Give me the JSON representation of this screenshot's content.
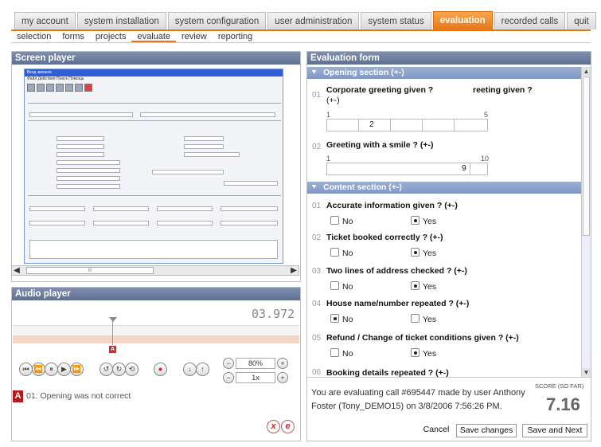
{
  "tabs": [
    "my account",
    "system installation",
    "system configuration",
    "user administration",
    "system status",
    "evaluation",
    "recorded calls",
    "quit"
  ],
  "active_tab": "evaluation",
  "subnav": [
    "selection",
    "forms",
    "projects",
    "evaluate",
    "review",
    "reporting"
  ],
  "active_sub": "evaluate",
  "screen_player": {
    "title": "Screen player",
    "scroll_label": "III"
  },
  "thumb": {
    "window_title": "Вход звонков",
    "menu": "Файл   Действия   Поиск   Помощь"
  },
  "audio_player": {
    "title": "Audio player",
    "time": "03.972",
    "marker": "A",
    "volume": "80%",
    "speed": "1x"
  },
  "comment": {
    "badge": "A",
    "text": "01: Opening was not correct"
  },
  "eval": {
    "title": "Evaluation form",
    "sections": [
      {
        "title": "Opening section (+-)"
      },
      {
        "title": "Content section (+-)"
      }
    ],
    "q1": {
      "num": "01",
      "text": "Corporate greeting given ?",
      "suffix": "(+-)",
      "overlay": "reeting given ?",
      "min": "1",
      "max": "5",
      "value": "2"
    },
    "q2": {
      "num": "02",
      "text": "Greeting with a smile ? (+-)",
      "min": "1",
      "max": "10",
      "value": "9"
    },
    "yesno": [
      {
        "num": "01",
        "text": "Accurate information given ? (+-)",
        "answer": "Yes"
      },
      {
        "num": "02",
        "text": "Ticket booked correctly ? (+-)",
        "answer": "Yes"
      },
      {
        "num": "03",
        "text": "Two lines of address checked ? (+-)",
        "answer": "Yes"
      },
      {
        "num": "04",
        "text": "House name/number repeated ? (+-)",
        "answer": "No"
      },
      {
        "num": "05",
        "text": "Refund / Change of ticket conditions given ? (+-)",
        "answer": "Yes"
      }
    ],
    "q6": {
      "num": "06",
      "text": "Booking details repeated ? (+-)"
    },
    "no_label": "No",
    "yes_label": "Yes"
  },
  "footer": {
    "info": "You are evaluating call #695447 made by user Anthony Foster (Tony_DEMO15) on 3/8/2006 7:56:26 PM.",
    "score_label": "SCORE (SO FAR)",
    "score": "7.16",
    "cancel": "Cancel",
    "save": "Save changes",
    "save_next": "Save and Next"
  }
}
